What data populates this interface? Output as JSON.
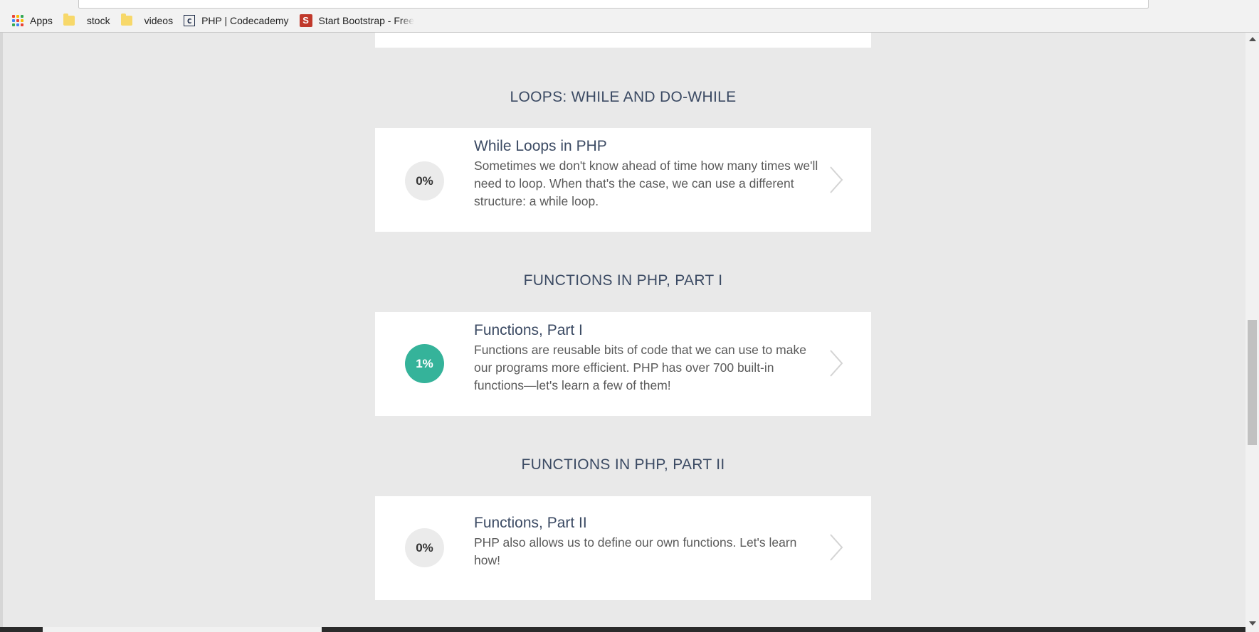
{
  "bookmarks": [
    {
      "label": "Apps",
      "icon": "apps-grid-icon"
    },
    {
      "label": "stock",
      "icon": "folder-icon"
    },
    {
      "label": "videos",
      "icon": "folder-icon"
    },
    {
      "label": "PHP | Codecademy",
      "icon": "codecademy-icon"
    },
    {
      "label": "Start Bootstrap - Free",
      "icon": "start-bootstrap-icon"
    }
  ],
  "colors": {
    "accent": "#35b39a",
    "heading": "#3b4a63",
    "background": "#e9e9e9"
  },
  "sections": [
    {
      "title": "LOOPS: WHILE AND DO-WHILE",
      "lesson": {
        "progress": "0%",
        "title": "While Loops in PHP",
        "description": "Sometimes we don't know ahead of time how many times we'll need to loop. When that's the case, we can use a different structure: a while loop."
      }
    },
    {
      "title": "FUNCTIONS IN PHP, PART I",
      "lesson": {
        "progress": "1%",
        "title": "Functions, Part I",
        "description": "Functions are reusable bits of code that we can use to make our programs more efficient. PHP has over 700 built-in functions—let's learn a few of them!"
      }
    },
    {
      "title": "FUNCTIONS IN PHP, PART II",
      "lesson": {
        "progress": "0%",
        "title": "Functions, Part II",
        "description": "PHP also allows us to define our own functions. Let's learn how!"
      }
    }
  ]
}
